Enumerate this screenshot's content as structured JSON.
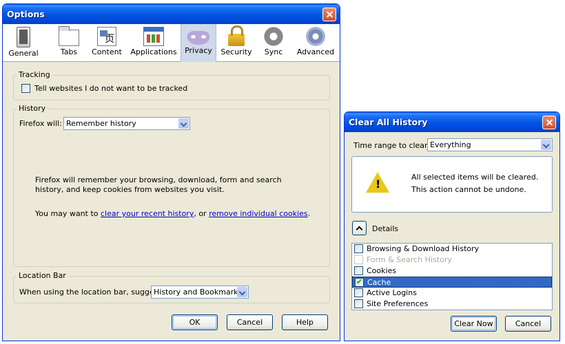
{
  "options": {
    "title": "Options",
    "toolbar": [
      {
        "label": "General",
        "icon": "general-icon"
      },
      {
        "label": "Tabs",
        "icon": "tabs-icon"
      },
      {
        "label": "Content",
        "icon": "content-icon"
      },
      {
        "label": "Applications",
        "icon": "applications-icon"
      },
      {
        "label": "Privacy",
        "icon": "privacy-mask-icon",
        "selected": true
      },
      {
        "label": "Security",
        "icon": "padlock-icon"
      },
      {
        "label": "Sync",
        "icon": "sync-icon"
      },
      {
        "label": "Advanced",
        "icon": "gear-icon"
      }
    ],
    "tracking": {
      "label": "Tracking",
      "checkbox_label": "Tell websites I do not want to be tracked",
      "checked": false
    },
    "history": {
      "label": "History",
      "firefox_will_label": "Firefox will:",
      "mode_value": "Remember history",
      "description": "Firefox will remember your browsing, download, form and search history, and keep cookies from websites you visit.",
      "want_to_prefix": "You may want to ",
      "clear_link": "clear your recent history",
      "or_text": ", or ",
      "remove_link": "remove individual cookies",
      "suffix": "."
    },
    "location_bar": {
      "label": "Location Bar",
      "suggest_label": "When using the location bar, suggest:",
      "suggest_value": "History and Bookmarks"
    },
    "buttons": {
      "ok": "OK",
      "cancel": "Cancel",
      "help": "Help"
    }
  },
  "clear_history": {
    "title": "Clear All History",
    "time_range_label": "Time range to clear:",
    "time_range_value": "Everything",
    "warning_line1": "All selected items will be cleared.",
    "warning_line2": "This action cannot be undone.",
    "details_label": "Details",
    "items": [
      {
        "label": "Browsing & Download History",
        "checked": false,
        "disabled": false,
        "selected": false
      },
      {
        "label": "Form & Search History",
        "checked": false,
        "disabled": true,
        "selected": false
      },
      {
        "label": "Cookies",
        "checked": false,
        "disabled": false,
        "selected": false
      },
      {
        "label": "Cache",
        "checked": true,
        "disabled": false,
        "selected": true
      },
      {
        "label": "Active Logins",
        "checked": false,
        "disabled": false,
        "selected": false
      },
      {
        "label": "Site Preferences",
        "checked": false,
        "disabled": false,
        "selected": false
      }
    ],
    "buttons": {
      "clear_now": "Clear Now",
      "cancel": "Cancel"
    }
  }
}
